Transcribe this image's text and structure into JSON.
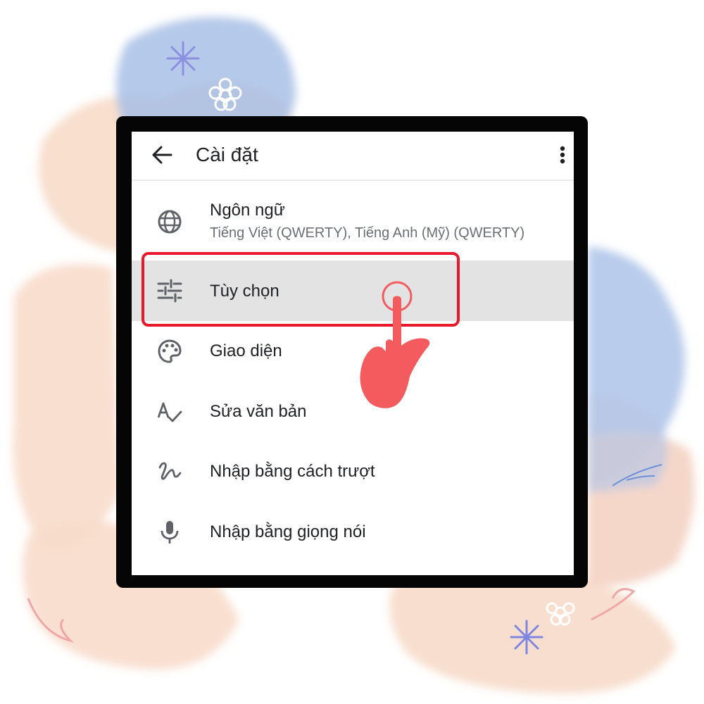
{
  "header": {
    "title": "Cài đặt",
    "back_icon": "back-arrow-icon",
    "menu_icon": "more-vert-icon"
  },
  "settings": [
    {
      "label": "Ngôn ngữ",
      "sub": "Tiếng Việt (QWERTY), Tiếng Anh (Mỹ) (QWERTY)",
      "icon": "globe-icon"
    },
    {
      "label": "Tùy chọn",
      "icon": "sliders-icon",
      "selected": true
    },
    {
      "label": "Giao diện",
      "icon": "palette-icon"
    },
    {
      "label": "Sửa văn bản",
      "icon": "text-check-icon"
    },
    {
      "label": "Nhập bằng cách trượt",
      "icon": "gesture-icon"
    },
    {
      "label": "Nhập bằng giọng nói",
      "icon": "mic-icon"
    }
  ],
  "colors": {
    "highlight": "#e8192c",
    "hand": "#f45b5e",
    "selected_row": "#e3e3e3"
  }
}
